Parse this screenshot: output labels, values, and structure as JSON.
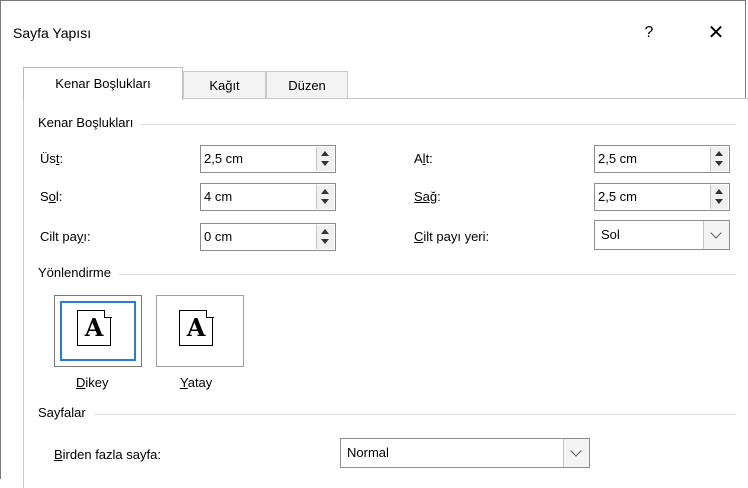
{
  "dialog": {
    "title": "Sayfa Yapısı",
    "help_label": "?",
    "close_label": "✕"
  },
  "tabs": [
    {
      "label": "Kenar Boşlukları",
      "active": true
    },
    {
      "label": "Kağıt",
      "active": false
    },
    {
      "label": "Düzen",
      "active": false
    }
  ],
  "margins": {
    "section_title": "Kenar Boşlukları",
    "top": {
      "label_pre": "Üs",
      "label_ul": "t",
      "label_post": ":",
      "value": "2,5 cm"
    },
    "bottom": {
      "label_pre": "A",
      "label_ul": "l",
      "label_post": "t:",
      "value": "2,5 cm"
    },
    "left": {
      "label_pre": "S",
      "label_ul": "o",
      "label_post": "l:",
      "value": "4 cm"
    },
    "right": {
      "label_pre": "",
      "label_ul": "Sağ",
      "label_post": ":",
      "value": "2,5 cm"
    },
    "gutter": {
      "label_pre": "Cilt pa",
      "label_ul": "y",
      "label_post": "ı:",
      "value": "0 cm"
    },
    "gutter_position": {
      "label_pre": "",
      "label_ul": "C",
      "label_post": "ilt payı yeri:",
      "value": "Sol"
    }
  },
  "orientation": {
    "section_title": "Yönlendirme",
    "portrait": {
      "label_ul": "D",
      "label_post": "ikey",
      "selected": true,
      "icon_glyph": "A"
    },
    "landscape": {
      "label_ul": "Y",
      "label_post": "atay",
      "selected": false,
      "icon_glyph": "A"
    }
  },
  "pages": {
    "section_title": "Sayfalar",
    "multiple": {
      "label_ul": "B",
      "label_post": "irden fazla sayfa:",
      "value": "Normal"
    }
  }
}
